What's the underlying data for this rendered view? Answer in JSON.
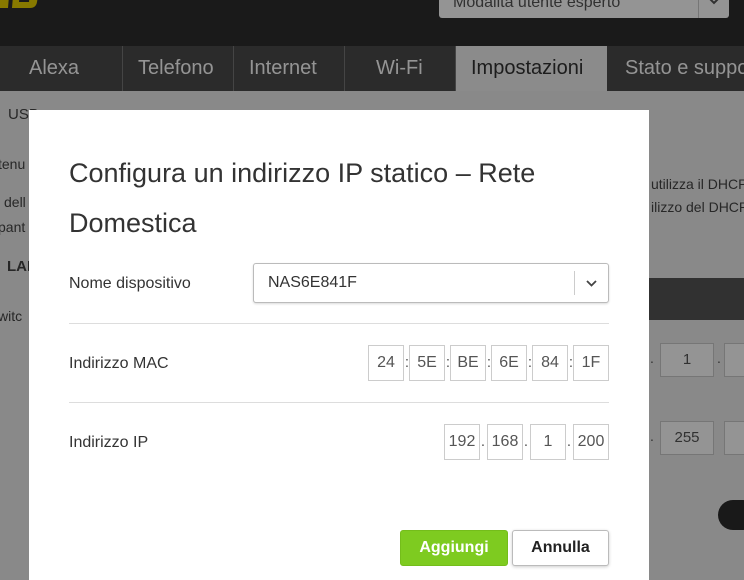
{
  "header": {
    "mode_select_value": "Modalità utente esperto"
  },
  "nav": {
    "tabs": [
      {
        "label": "Alexa"
      },
      {
        "label": "Telefono"
      },
      {
        "label": "Internet"
      },
      {
        "label": "Wi-Fi"
      },
      {
        "label": "Impostazioni",
        "active": true
      },
      {
        "label": "Stato e supporto"
      }
    ]
  },
  "background": {
    "sidebar_usb": "USB",
    "sidebar_tenu": "tenu",
    "sidebar_dell": "dell",
    "sidebar_pant": "pant",
    "sidebar_lan": "LAN",
    "sidebar_switch": "witc",
    "right_text_1": "utilizza il DHCP",
    "right_text_2": "ilizzo del DHCP",
    "row1_value": "1",
    "row2_value": "255"
  },
  "modal": {
    "title": "Configura un indirizzo IP statico – Rete Domestica",
    "device_name_label": "Nome dispositivo",
    "device_name_value": "NAS6E841F",
    "mac_label": "Indirizzo MAC",
    "mac_octets": [
      "24",
      "5E",
      "BE",
      "6E",
      "84",
      "1F"
    ],
    "ip_label": "Indirizzo IP",
    "ip_octets": [
      "192",
      "168",
      "1",
      "200"
    ],
    "add_button": "Aggiungi",
    "cancel_button": "Annulla"
  },
  "colors": {
    "primary_green": "#7ecb20",
    "brand_yellow": "#e8d000",
    "nav_background": "#4a4a4a",
    "topbar_background": "#2e2e2e"
  }
}
